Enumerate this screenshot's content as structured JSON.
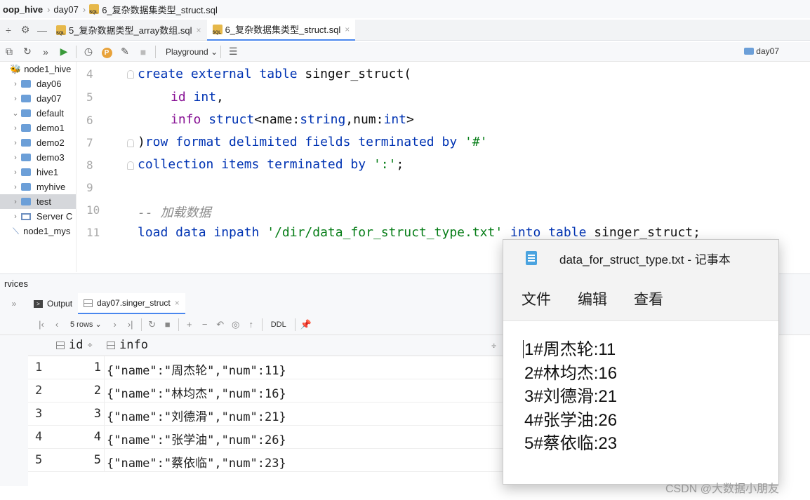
{
  "breadcrumb": {
    "root": "oop_hive",
    "folder": "day07",
    "file": "6_复杂数据集类型_struct.sql"
  },
  "tabs": [
    {
      "label": "5_复杂数据类型_array数组.sql",
      "close": "×"
    },
    {
      "label": "6_复杂数据集类型_struct.sql",
      "close": "×"
    }
  ],
  "toolbar": {
    "profile_badge": "P",
    "playground_label": "Playground",
    "schema_label": "day07"
  },
  "sidebar": {
    "root_label": "node1_hive",
    "items": [
      {
        "label": "day06",
        "chevron": "›"
      },
      {
        "label": "day07",
        "chevron": "›"
      },
      {
        "label": "default",
        "chevron": "⌄"
      },
      {
        "label": "demo1",
        "chevron": "›"
      },
      {
        "label": "demo2",
        "chevron": "›"
      },
      {
        "label": "demo3",
        "chevron": "›"
      },
      {
        "label": "hive1",
        "chevron": "›"
      },
      {
        "label": "myhive",
        "chevron": "›"
      },
      {
        "label": "test",
        "chevron": "›"
      }
    ],
    "server_label": "Server C",
    "mysql_label": "node1_mys"
  },
  "editor": {
    "line_numbers": [
      "4",
      "5",
      "6",
      "7",
      "8",
      "9",
      "10",
      "11"
    ],
    "lines": {
      "l4_kw": "create external table",
      "l4_rest": " singer_struct(",
      "l5_field": "id",
      "l5_type": "int",
      "l5_rest": ",",
      "l6_field": "info",
      "l6_type": "struct",
      "l6_mid1": "<name:",
      "l6_t2": "string",
      "l6_mid2": ",num:",
      "l6_t3": "int",
      "l6_end": ">",
      "l7_paren": ")",
      "l7_kw": "row format delimited fields terminated by",
      "l7_str": "'#'",
      "l8_kw": "collection items terminated by",
      "l8_str": "':'",
      "l8_end": ";",
      "l10_comment": "-- 加载数据",
      "l11_kw1": "load data inpath",
      "l11_str": "'/dir/data_for_struct_type.txt'",
      "l11_kw2": "into table",
      "l11_rest": " singer_struct;"
    }
  },
  "services": {
    "title": "rvices",
    "output_tab": "Output",
    "result_tab": "day07.singer_struct",
    "rows_label": "5 rows",
    "ddl_label": "DDL"
  },
  "result_grid": {
    "columns": [
      "id",
      "info"
    ],
    "rows": [
      {
        "rn": "1",
        "id": "1",
        "info": "{\"name\":\"周杰轮\",\"num\":11}"
      },
      {
        "rn": "2",
        "id": "2",
        "info": "{\"name\":\"林均杰\",\"num\":16}"
      },
      {
        "rn": "3",
        "id": "3",
        "info": "{\"name\":\"刘德滑\",\"num\":21}"
      },
      {
        "rn": "4",
        "id": "4",
        "info": "{\"name\":\"张学油\",\"num\":26}"
      },
      {
        "rn": "5",
        "id": "5",
        "info": "{\"name\":\"蔡依临\",\"num\":23}"
      }
    ]
  },
  "notepad": {
    "title": "data_for_struct_type.txt - 记事本",
    "menu": [
      "文件",
      "编辑",
      "查看"
    ],
    "lines": [
      "1#周杰轮:11",
      "2#林均杰:16",
      "3#刘德滑:21",
      "4#张学油:26",
      "5#蔡依临:23"
    ]
  },
  "watermark": "CSDN @大数据小朋友"
}
